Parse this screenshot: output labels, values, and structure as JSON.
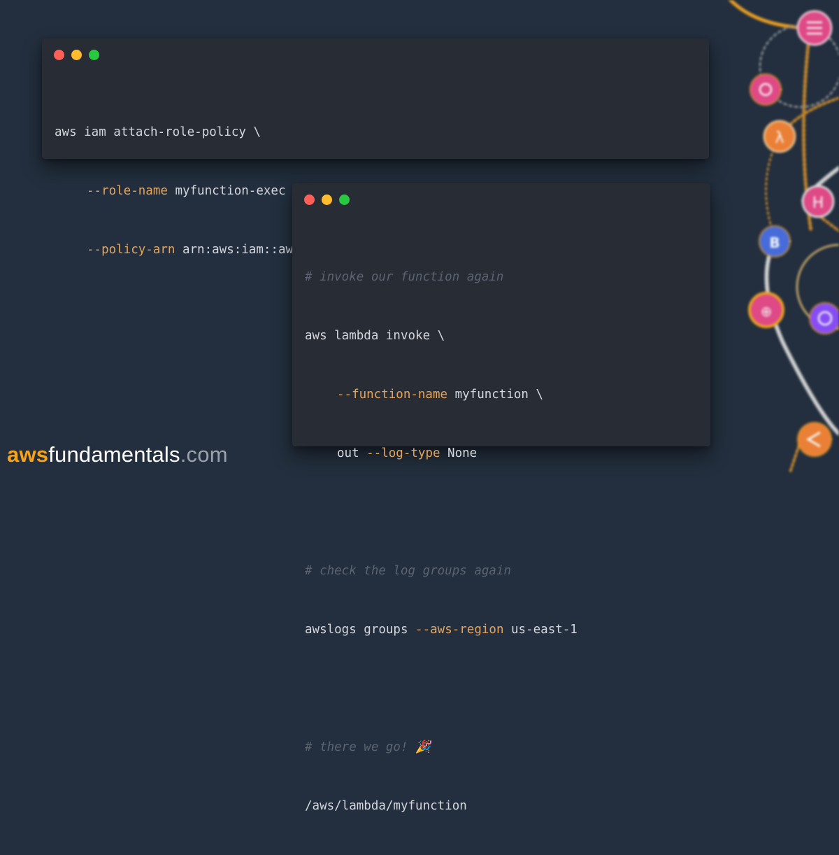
{
  "colors": {
    "background": "#232f3e",
    "window": "#282c34",
    "flag": "#e3a55e",
    "comment": "#5c6370",
    "text": "#d4d7dd",
    "dot_red": "#ff5f57",
    "dot_yellow": "#febc2e",
    "dot_green": "#28c840",
    "brand_accent": "#f7a21b"
  },
  "window_1": {
    "lines": [
      {
        "cmd": "aws iam attach-role-policy \\"
      },
      {
        "flag": "--role-name",
        "rest": " myfunction-exec \\"
      },
      {
        "flag": "--policy-arn",
        "rest": " arn:aws:iam::aws:policy/service-role/AWSLambdaBasicExecutionRole"
      }
    ]
  },
  "window_2": {
    "comment_1": "# invoke our function again",
    "invoke_cmd": "aws lambda invoke \\",
    "function_flag": "--function-name",
    "function_rest": " myfunction \\",
    "out_prefix": "out ",
    "log_flag": "--log-type",
    "log_rest": " None",
    "comment_2": "# check the log groups again",
    "groups_cmd": "awslogs groups ",
    "region_flag": "--aws-region",
    "region_rest": " us-east-1",
    "comment_3": "# there we go! 🎉",
    "output": "/aws/lambda/myfunction"
  },
  "brand": {
    "aws": "aws",
    "fundamentals": "fundamentals",
    "com": ".com"
  },
  "decoration_icons": [
    "glue-icon",
    "eventbridge-icon",
    "lambda-icon",
    "hsm-icon",
    "beanstalk-icon",
    "iot-icon",
    "vpc-icon",
    "edge-icon"
  ]
}
